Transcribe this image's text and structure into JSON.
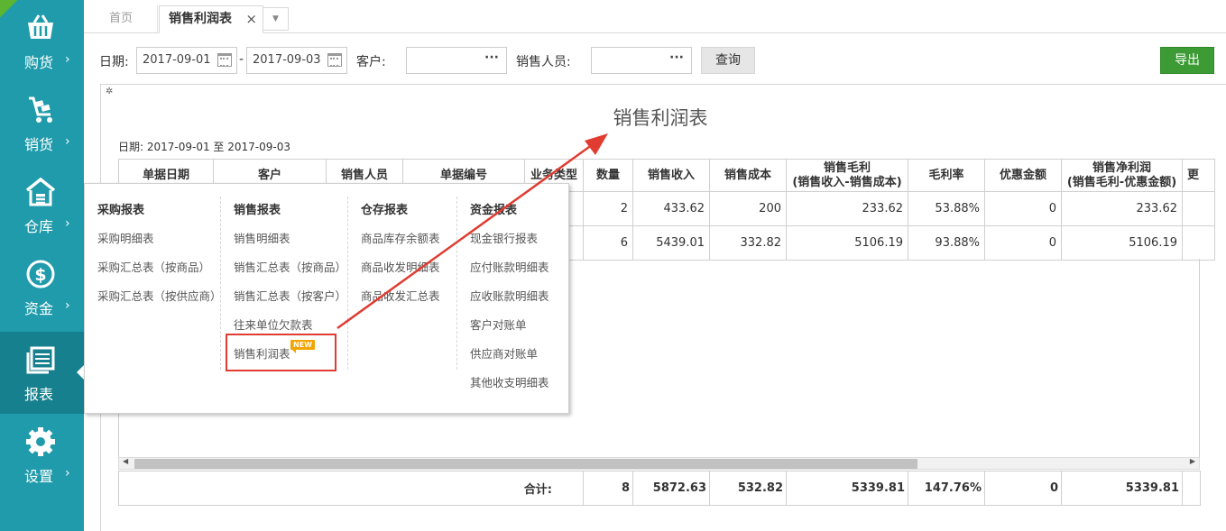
{
  "sidebar": {
    "items": [
      {
        "label": "购货",
        "icon": "basket-icon",
        "chevron": "›"
      },
      {
        "label": "销货",
        "icon": "cart-icon",
        "chevron": "›"
      },
      {
        "label": "仓库",
        "icon": "warehouse-icon",
        "chevron": "›"
      },
      {
        "label": "资金",
        "icon": "dollar-coin-icon",
        "chevron": "›"
      },
      {
        "label": "报表",
        "icon": "report-icon"
      },
      {
        "label": "设置",
        "icon": "gear-icon",
        "chevron": "›"
      }
    ],
    "bg_color": "#1f9bab",
    "active_color": "#17808e"
  },
  "tabs": {
    "home": "首页",
    "active": "销售利润表",
    "close": "×",
    "more": "▼"
  },
  "filters": {
    "date_label": "日期:",
    "date_from": "2017-09-01",
    "date_sep": "-",
    "date_to": "2017-09-03",
    "customer_label": "客户:",
    "customer_value": "",
    "customer_dots": "···",
    "sales_label": "销售人员:",
    "sales_value": "",
    "sales_dots": "···",
    "query_button": "查询",
    "export_button": "导出"
  },
  "report": {
    "title": "销售利润表",
    "date_range": "日期: 2017-09-01 至 2017-09-03",
    "headers": {
      "date": "单据日期",
      "customer": "客户",
      "salesperson": "销售人员",
      "doc_no": "单据编号",
      "biz_type": "业务类型",
      "qty": "数量",
      "revenue": "销售收入",
      "cost": "销售成本",
      "gross_line1": "销售毛利",
      "gross_line2": "(销售收入-销售成本)",
      "margin": "毛利率",
      "discount": "优惠金额",
      "net_line1": "销售净利润",
      "net_line2": "(销售毛利-优惠金额)",
      "extra": "更"
    },
    "rows": [
      {
        "qty": "2",
        "revenue": "433.62",
        "cost": "200",
        "gross": "233.62",
        "margin": "53.88%",
        "discount": "0",
        "net": "233.62"
      },
      {
        "qty": "6",
        "revenue": "5439.01",
        "cost": "332.82",
        "gross": "5106.19",
        "margin": "93.88%",
        "discount": "0",
        "net": "5106.19"
      }
    ],
    "total": {
      "label": "合计:",
      "qty": "8",
      "revenue": "5872.63",
      "cost": "532.82",
      "gross": "5339.81",
      "margin": "147.76%",
      "discount": "0",
      "net": "5339.81"
    },
    "scroll_left": "◀",
    "scroll_right": "▶"
  },
  "menu": {
    "columns": [
      {
        "title": "采购报表",
        "items": [
          "采购明细表",
          "采购汇总表（按商品）",
          "采购汇总表（按供应商）"
        ]
      },
      {
        "title": "销售报表",
        "items": [
          "销售明细表",
          "销售汇总表（按商品）",
          "销售汇总表（按客户）",
          "往来单位欠款表",
          "销售利润表"
        ]
      },
      {
        "title": "仓存报表",
        "items": [
          "商品库存余额表",
          "商品收发明细表",
          "商品收发汇总表"
        ]
      },
      {
        "title": "资金报表",
        "items": [
          "现金银行报表",
          "应付账款明细表",
          "应收账款明细表",
          "客户对账单",
          "供应商对账单",
          "其他收支明细表"
        ]
      }
    ],
    "new_badge": "NEW"
  },
  "colors": {
    "export_green": "#3c9b35",
    "highlight_red": "#e03c31",
    "badge_orange": "#f2a400"
  }
}
